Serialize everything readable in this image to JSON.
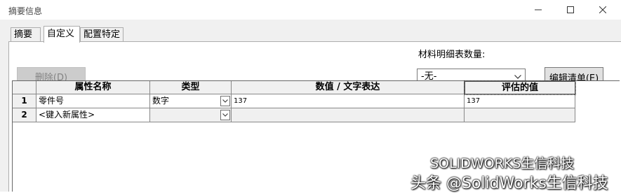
{
  "window": {
    "title": "摘要信息",
    "minimize_icon": "minimize-icon",
    "maximize_icon": "maximize-icon",
    "close_icon": "close-icon"
  },
  "tabs": [
    {
      "label": "摘要",
      "active": false
    },
    {
      "label": "自定义",
      "active": true
    },
    {
      "label": "配置特定",
      "active": false
    }
  ],
  "toolbar": {
    "delete_label": "删除(D)",
    "bom_quantity_label": "材料明细表数量:",
    "bom_quantity_value": "-无-",
    "edit_list_label": "编辑清单(E)"
  },
  "table": {
    "columns": [
      "属性名称",
      "类型",
      "数值 / 文字表达",
      "评估的值"
    ],
    "rows": [
      {
        "index": "1",
        "name": "零件号",
        "type": "数字",
        "value": "137",
        "evaluated": "137"
      },
      {
        "index": "2",
        "name": "<键入新属性>",
        "type": "",
        "value": "",
        "evaluated": ""
      }
    ]
  },
  "watermark": {
    "line1": "SOLIDWORKS生信科技",
    "line2": "头条 @SolidWorks生信科技"
  },
  "colors": {
    "panel_bg": "#f0f0f0",
    "disabled_button_bg": "#cccccc",
    "disabled_text": "#838383"
  }
}
